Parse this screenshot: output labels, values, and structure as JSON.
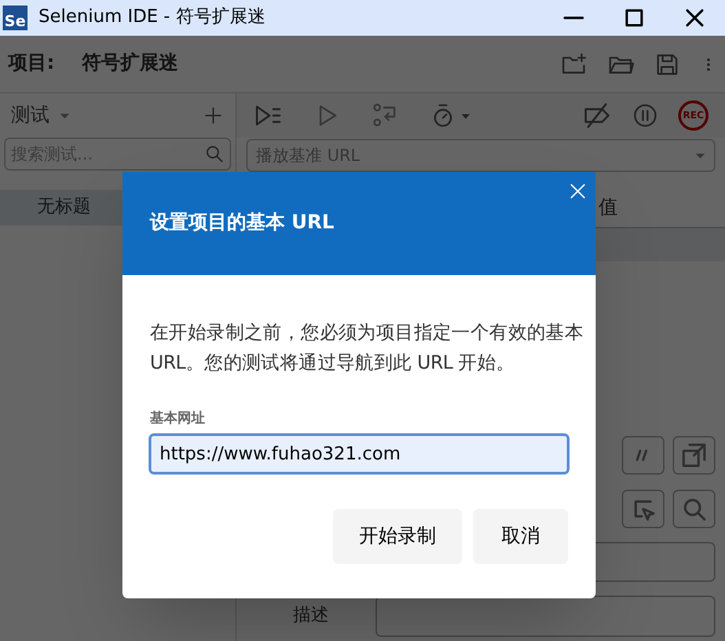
{
  "window": {
    "logo": "Se",
    "title": "Selenium IDE - 符号扩展迷"
  },
  "project": {
    "label": "项目:",
    "name": "符号扩展迷"
  },
  "tests_panel": {
    "title": "测试",
    "search": {
      "placeholder": "搜索测试..."
    },
    "items": [
      {
        "label": "无标题",
        "selected": true
      }
    ]
  },
  "toolbar": {
    "rec_label": "REC",
    "base_url": {
      "placeholder": "播放基准 URL"
    }
  },
  "table": {
    "columns": [
      "值"
    ]
  },
  "editor": {
    "description_label": "描述"
  },
  "dialog": {
    "title": "设置项目的基本 URL",
    "message": "在开始录制之前，您必须为项目指定一个有效的基本 URL。您的测试将通过导航到此 URL 开始。",
    "field": {
      "label": "基本网址",
      "value": "https://www.fuhao321.com"
    },
    "buttons": [
      "开始录制",
      "取消"
    ]
  }
}
